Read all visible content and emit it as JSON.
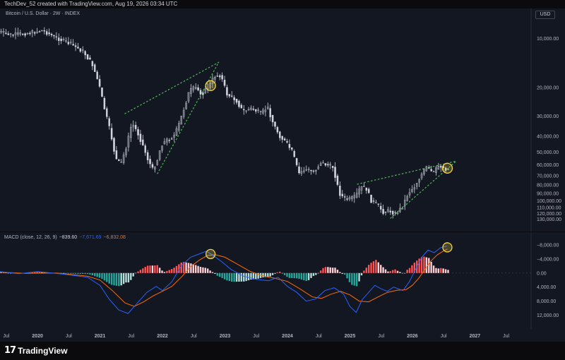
{
  "header": {
    "caption": "TechDev_52 created with TradingView.com, Aug 19, 2026 03:34 UTC"
  },
  "price_panel": {
    "title": "Bitcoin / U.S. Dollar · 2W · INDEX",
    "currency_button": "USD"
  },
  "macd_panel": {
    "title": "MACD (close, 12, 26, 9)",
    "hist_value": "−839.60",
    "macd_value": "−7,671.69",
    "signal_value": "−6,832.08"
  },
  "footer": {
    "brand": "TradingView",
    "logo_mark": "17"
  },
  "colors": {
    "background": "#131722",
    "candle": "#d1d4dc",
    "dotted_line": "#4caf50",
    "circle": "#f0d24a",
    "macd": "#2962ff",
    "signal": "#ff6d00",
    "hist_up_strong": "#26a69a",
    "hist_up_weak": "#b2dfdb",
    "hist_down_strong": "#ff5252",
    "hist_down_weak": "#ffcdd2"
  },
  "chart_data": [
    {
      "type": "candlestick",
      "title": "Bitcoin / U.S. Dollar · 2W · INDEX",
      "y_scale": "inverted-log",
      "ylim": [
        7500,
        140000
      ],
      "y_ticks": [
        10000,
        20000,
        30000,
        40000,
        50000,
        60000,
        70000,
        80000,
        90000,
        100000,
        110000,
        120000,
        130000
      ],
      "y_tick_labels": [
        "10,000.00",
        "20,000.00",
        "30,000.00",
        "40,000.00",
        "50,000.00",
        "60,000.00",
        "70,000.00",
        "80,000.00",
        "90,000.00",
        "100,000.00",
        "110,000.00",
        "120,000.00",
        "130,000.00"
      ],
      "x_ticks": [
        2019.5,
        2020,
        2020.5,
        2021,
        2021.5,
        2022,
        2022.5,
        2023,
        2023.5,
        2024,
        2024.5,
        2025,
        2025.5,
        2026,
        2026.5,
        2027,
        2027.5
      ],
      "x_tick_labels": [
        "Jul",
        "2020",
        "Jul",
        "2021",
        "Jul",
        "2022",
        "Jul",
        "2023",
        "Jul",
        "2024",
        "Jul",
        "2025",
        "Jul",
        "2026",
        "Jul",
        "2027",
        "Jul"
      ],
      "xlim": [
        2019.4,
        2027.9
      ],
      "price_path": [
        [
          2019.36,
          9000
        ],
        [
          2019.6,
          9500
        ],
        [
          2019.9,
          9200
        ],
        [
          2020.1,
          8900
        ],
        [
          2020.3,
          9800
        ],
        [
          2020.55,
          10800
        ],
        [
          2020.75,
          12000
        ],
        [
          2020.9,
          14500
        ],
        [
          2021.0,
          19000
        ],
        [
          2021.1,
          28000
        ],
        [
          2021.2,
          40000
        ],
        [
          2021.27,
          55000
        ],
        [
          2021.35,
          60000
        ],
        [
          2021.45,
          45000
        ],
        [
          2021.53,
          33000
        ],
        [
          2021.62,
          38000
        ],
        [
          2021.7,
          45000
        ],
        [
          2021.78,
          55000
        ],
        [
          2021.86,
          64000
        ],
        [
          2021.93,
          57000
        ],
        [
          2022.0,
          45000
        ],
        [
          2022.1,
          42000
        ],
        [
          2022.2,
          40000
        ],
        [
          2022.27,
          35000
        ],
        [
          2022.35,
          28000
        ],
        [
          2022.45,
          21000
        ],
        [
          2022.55,
          20000
        ],
        [
          2022.65,
          22000
        ],
        [
          2022.75,
          20000
        ],
        [
          2022.85,
          17000
        ],
        [
          2022.95,
          16800
        ],
        [
          2023.05,
          22000
        ],
        [
          2023.2,
          24000
        ],
        [
          2023.3,
          28000
        ],
        [
          2023.45,
          27000
        ],
        [
          2023.6,
          29000
        ],
        [
          2023.7,
          26500
        ],
        [
          2023.8,
          34000
        ],
        [
          2023.9,
          40000
        ],
        [
          2024.0,
          44000
        ],
        [
          2024.1,
          50000
        ],
        [
          2024.2,
          68000
        ],
        [
          2024.3,
          64000
        ],
        [
          2024.45,
          66000
        ],
        [
          2024.55,
          58000
        ],
        [
          2024.65,
          60000
        ],
        [
          2024.75,
          62000
        ],
        [
          2024.85,
          90000
        ],
        [
          2024.93,
          97000
        ],
        [
          2025.0,
          98000
        ],
        [
          2025.1,
          95000
        ],
        [
          2025.2,
          82000
        ],
        [
          2025.28,
          84000
        ],
        [
          2025.36,
          100000
        ],
        [
          2025.45,
          105000
        ],
        [
          2025.55,
          117000
        ],
        [
          2025.65,
          115000
        ],
        [
          2025.75,
          120000
        ],
        [
          2025.85,
          110000
        ],
        [
          2025.95,
          90000
        ],
        [
          2026.05,
          82000
        ],
        [
          2026.15,
          70000
        ],
        [
          2026.25,
          62000
        ],
        [
          2026.35,
          68000
        ],
        [
          2026.45,
          60000
        ],
        [
          2026.52,
          63000
        ],
        [
          2026.58,
          64000
        ]
      ],
      "overlays": [
        {
          "type": "dotted-line",
          "points": [
            [
              2021.4,
              29000
            ],
            [
              2022.9,
              14000
            ]
          ]
        },
        {
          "type": "dotted-line",
          "points": [
            [
              2021.92,
              68000
            ],
            [
              2022.9,
              14000
            ]
          ]
        },
        {
          "type": "dotted-line",
          "points": [
            [
              2025.12,
              79000
            ],
            [
              2026.7,
              57000
            ]
          ]
        },
        {
          "type": "dotted-line",
          "points": [
            [
              2025.65,
              128000
            ],
            [
              2026.7,
              57000
            ]
          ]
        },
        {
          "type": "circle-marker",
          "at": [
            2022.77,
            19500
          ]
        },
        {
          "type": "circle-marker",
          "at": [
            2026.56,
            63000
          ]
        }
      ]
    },
    {
      "type": "macd",
      "title": "MACD (close, 12, 26, 9)",
      "y_scale": "inverted",
      "ylim": [
        -10000,
        14500
      ],
      "y_ticks": [
        -8000,
        -4000,
        0,
        4000,
        8000,
        12000
      ],
      "y_tick_labels": [
        "−8,000.00",
        "−4,000.00",
        "0.00",
        "4,000.00",
        "8,000.00",
        "12,000.00"
      ],
      "macd_path": [
        [
          2019.36,
          -500
        ],
        [
          2019.7,
          200
        ],
        [
          2020.0,
          -400
        ],
        [
          2020.4,
          300
        ],
        [
          2020.8,
          1200
        ],
        [
          2021.0,
          3500
        ],
        [
          2021.15,
          7500
        ],
        [
          2021.3,
          10500
        ],
        [
          2021.45,
          11500
        ],
        [
          2021.6,
          8500
        ],
        [
          2021.75,
          5500
        ],
        [
          2021.9,
          3800
        ],
        [
          2022.0,
          5000
        ],
        [
          2022.15,
          2500
        ],
        [
          2022.3,
          -2000
        ],
        [
          2022.45,
          -4500
        ],
        [
          2022.6,
          -5500
        ],
        [
          2022.7,
          -6200
        ],
        [
          2022.8,
          -5200
        ],
        [
          2022.95,
          -3200
        ],
        [
          2023.1,
          -1000
        ],
        [
          2023.3,
          900
        ],
        [
          2023.5,
          1800
        ],
        [
          2023.7,
          2200
        ],
        [
          2023.85,
          1200
        ],
        [
          2024.0,
          3800
        ],
        [
          2024.15,
          5500
        ],
        [
          2024.3,
          8000
        ],
        [
          2024.45,
          7400
        ],
        [
          2024.6,
          5000
        ],
        [
          2024.75,
          4200
        ],
        [
          2024.9,
          6000
        ],
        [
          2025.0,
          9500
        ],
        [
          2025.1,
          11200
        ],
        [
          2025.2,
          7500
        ],
        [
          2025.3,
          5500
        ],
        [
          2025.4,
          3500
        ],
        [
          2025.5,
          4500
        ],
        [
          2025.6,
          5200
        ],
        [
          2025.7,
          4000
        ],
        [
          2025.85,
          5000
        ],
        [
          2025.95,
          2500
        ],
        [
          2026.05,
          -1000
        ],
        [
          2026.15,
          -4500
        ],
        [
          2026.25,
          -6500
        ],
        [
          2026.35,
          -5800
        ],
        [
          2026.45,
          -7200
        ],
        [
          2026.55,
          -7672
        ]
      ],
      "signal_path": [
        [
          2019.36,
          -300
        ],
        [
          2019.8,
          100
        ],
        [
          2020.3,
          0
        ],
        [
          2020.8,
          900
        ],
        [
          2021.0,
          2000
        ],
        [
          2021.2,
          5000
        ],
        [
          2021.4,
          8500
        ],
        [
          2021.55,
          9500
        ],
        [
          2021.7,
          8200
        ],
        [
          2021.85,
          6500
        ],
        [
          2022.0,
          5200
        ],
        [
          2022.15,
          3800
        ],
        [
          2022.3,
          1200
        ],
        [
          2022.45,
          -1800
        ],
        [
          2022.6,
          -3800
        ],
        [
          2022.72,
          -5000
        ],
        [
          2022.85,
          -5200
        ],
        [
          2023.0,
          -4500
        ],
        [
          2023.2,
          -2500
        ],
        [
          2023.4,
          -500
        ],
        [
          2023.6,
          800
        ],
        [
          2023.8,
          1500
        ],
        [
          2024.0,
          2400
        ],
        [
          2024.2,
          4500
        ],
        [
          2024.4,
          6800
        ],
        [
          2024.55,
          7200
        ],
        [
          2024.7,
          6000
        ],
        [
          2024.85,
          5200
        ],
        [
          2025.0,
          6200
        ],
        [
          2025.15,
          8000
        ],
        [
          2025.3,
          8200
        ],
        [
          2025.45,
          6800
        ],
        [
          2025.6,
          5500
        ],
        [
          2025.75,
          4900
        ],
        [
          2025.9,
          4700
        ],
        [
          2026.0,
          3500
        ],
        [
          2026.1,
          1500
        ],
        [
          2026.2,
          -1000
        ],
        [
          2026.3,
          -3500
        ],
        [
          2026.4,
          -5200
        ],
        [
          2026.5,
          -6300
        ],
        [
          2026.56,
          -6832
        ]
      ],
      "overlays": [
        {
          "type": "circle-marker",
          "at": [
            2022.77,
            -5400
          ]
        },
        {
          "type": "circle-marker",
          "at": [
            2026.56,
            -7300
          ]
        }
      ]
    }
  ]
}
